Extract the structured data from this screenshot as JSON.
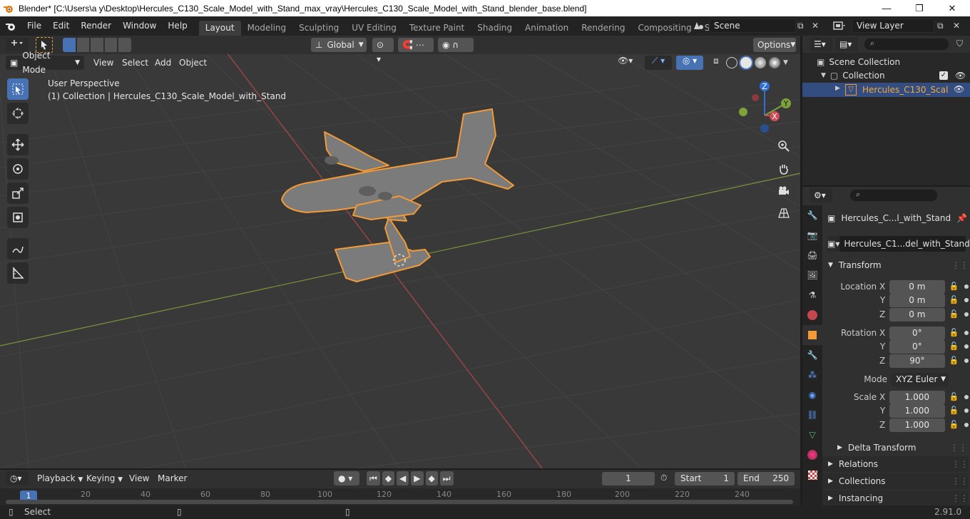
{
  "window": {
    "title": "Blender* [C:\\Users\\a y\\Desktop\\Hercules_C130_Scale_Model_with_Stand_max_vray\\Hercules_C130_Scale_Model_with_Stand_blender_base.blend]",
    "minimize": "—",
    "maximize": "❐",
    "close": "✕"
  },
  "menu": [
    "File",
    "Edit",
    "Render",
    "Window",
    "Help"
  ],
  "workspaces": [
    "Layout",
    "Modeling",
    "Sculpting",
    "UV Editing",
    "Texture Paint",
    "Shading",
    "Animation",
    "Rendering",
    "Compositing",
    "Scripting"
  ],
  "workspace_add": "+",
  "scene": {
    "name": "Scene"
  },
  "view_layer": {
    "name": "View Layer"
  },
  "viewport": {
    "transform_orientation": "Global",
    "options": "Options",
    "mode": "Object Mode",
    "menus": [
      "View",
      "Select",
      "Add",
      "Object"
    ],
    "overlay_line1": "User Perspective",
    "overlay_line2": "(1) Collection | Hercules_C130_Scale_Model_with_Stand",
    "gizmo": {
      "x": "X",
      "y": "Y",
      "z": "Z"
    }
  },
  "outliner": {
    "scene_collection": "Scene Collection",
    "collection": "Collection",
    "object": "Hercules_C130_Scal"
  },
  "properties": {
    "object_name": "Hercules_C...l_with_Stand",
    "data_name": "Hercules_C1...del_with_Stand",
    "transform_label": "Transform",
    "location_label": "Location X",
    "rotation_label": "Rotation X",
    "scale_label": "Scale X",
    "y_label": "Y",
    "z_label": "Z",
    "location": [
      "0 m",
      "0 m",
      "0 m"
    ],
    "rotation": [
      "0°",
      "0°",
      "90°"
    ],
    "mode_label": "Mode",
    "mode_value": "XYZ Euler",
    "scale": [
      "1.000",
      "1.000",
      "1.000"
    ],
    "delta": "Delta Transform",
    "relations": "Relations",
    "collections": "Collections",
    "instancing": "Instancing"
  },
  "timeline": {
    "menus": [
      "Playback",
      "Keying",
      "View",
      "Marker"
    ],
    "current_frame": "1",
    "start_label": "Start",
    "start": "1",
    "end_label": "End",
    "end": "250",
    "ruler": [
      "1",
      "20",
      "40",
      "60",
      "80",
      "100",
      "120",
      "140",
      "160",
      "180",
      "200",
      "220",
      "240"
    ]
  },
  "status": {
    "left": "Select",
    "version": "2.91.0"
  },
  "colors": {
    "accent": "#4772b3",
    "selection": "#f29a36",
    "x_axis": "#d04c55",
    "y_axis": "#7ea23a",
    "z_axis": "#2f6fd6"
  }
}
